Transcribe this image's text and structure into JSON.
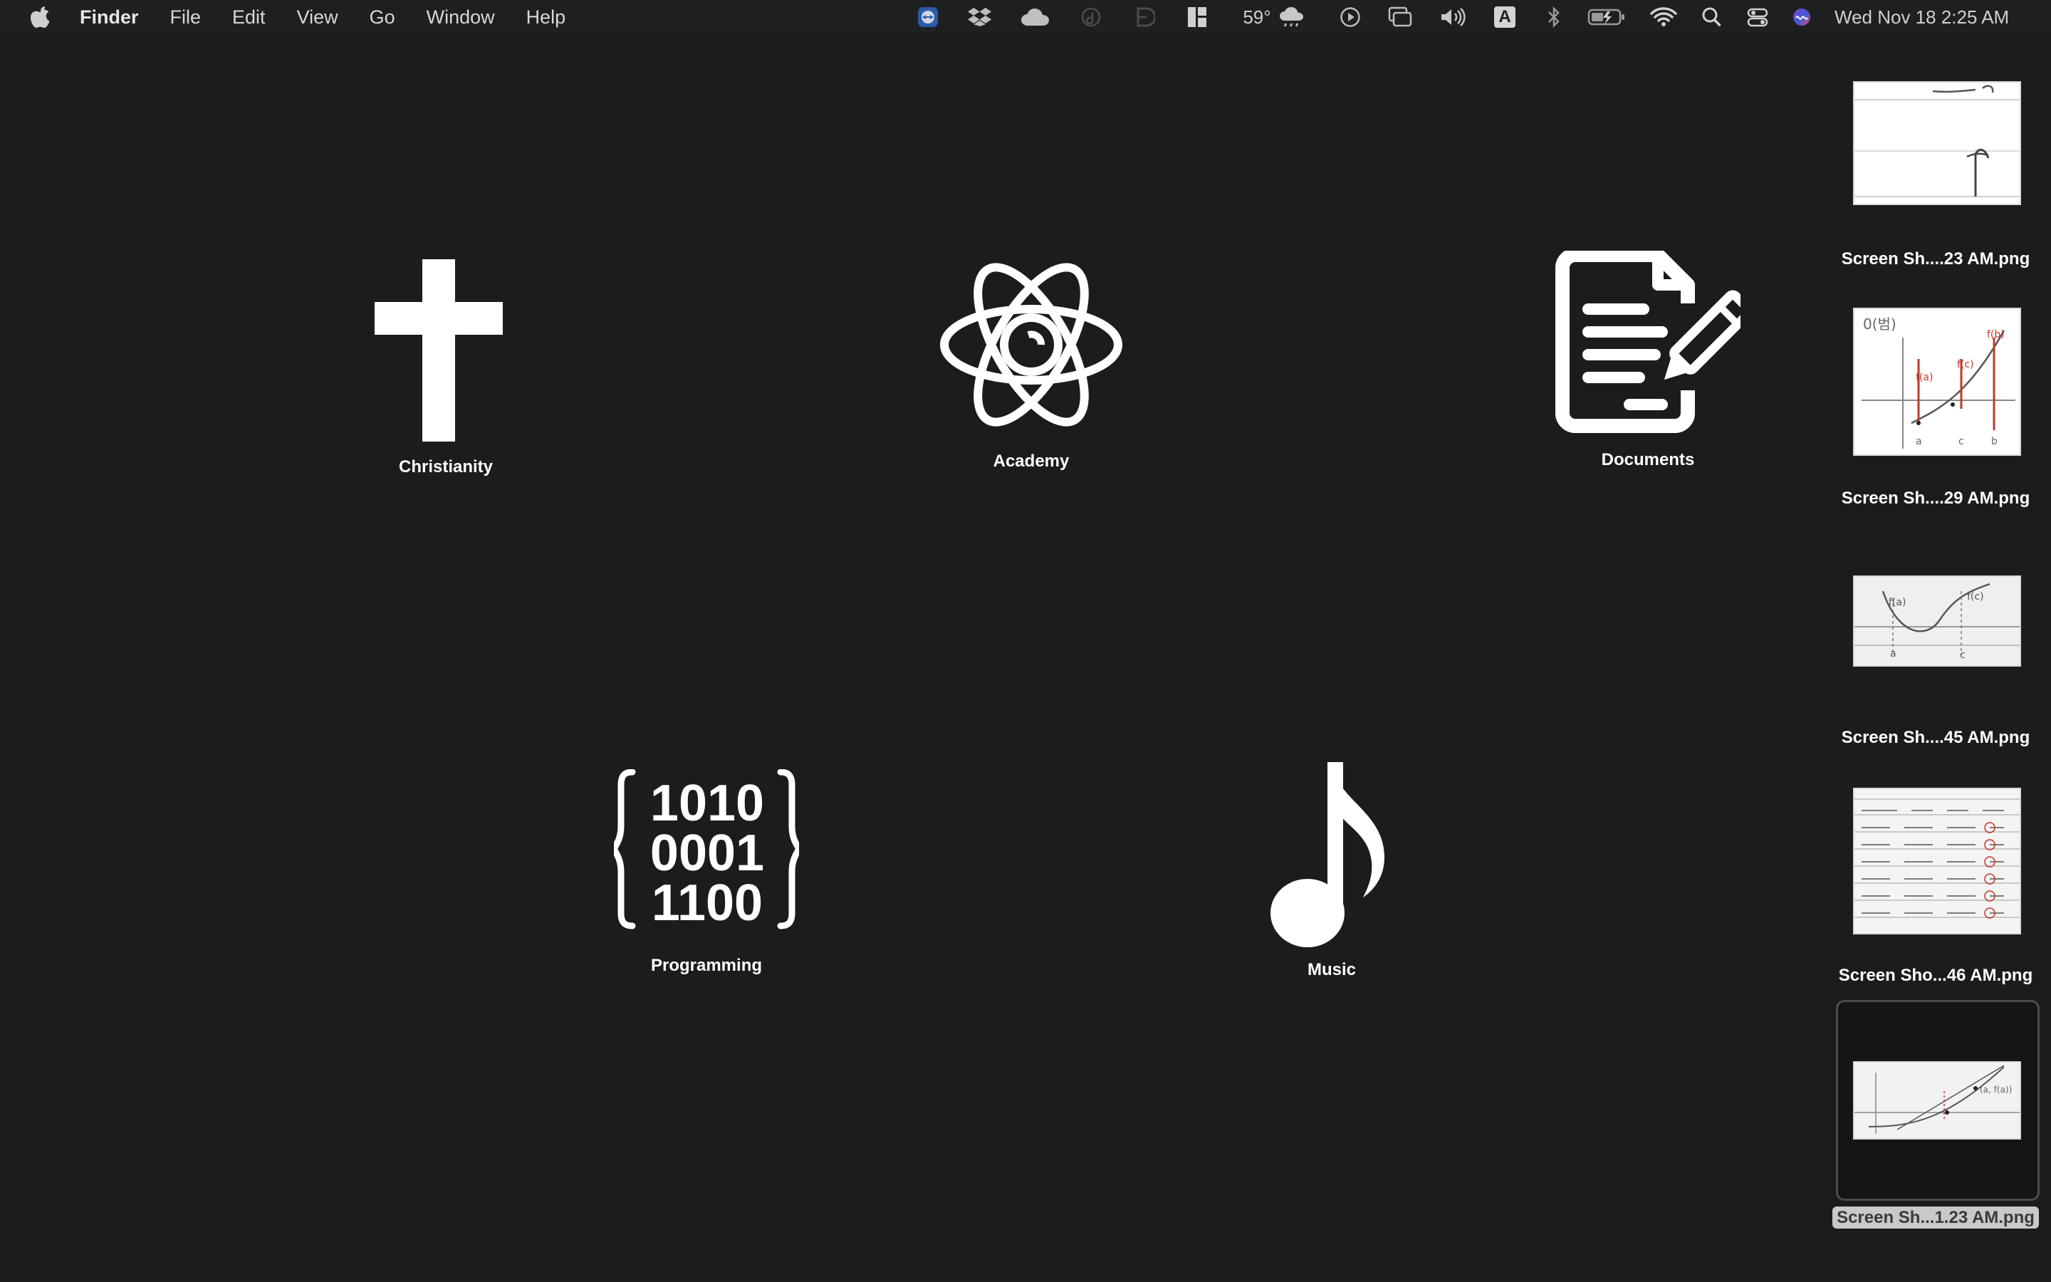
{
  "menubar": {
    "app_name": "Finder",
    "menus": [
      "File",
      "Edit",
      "View",
      "Go",
      "Window",
      "Help"
    ],
    "weather_temp": "59°",
    "clock": "Wed Nov 18  2:25 AM",
    "input_source": "A",
    "status_icons": [
      "teamviewer-icon",
      "dropbox-icon",
      "cloud-icon",
      "dash-icon",
      "bartender-icon",
      "layout-icon",
      "weather-icon",
      "play-icon",
      "screens-icon",
      "volume-icon",
      "input-source-icon",
      "bluetooth-icon",
      "battery-icon",
      "wifi-icon",
      "spotlight-icon",
      "control-center-icon",
      "siri-icon"
    ]
  },
  "desktop": {
    "folders": [
      {
        "label": "Christianity",
        "icon": "cross-icon"
      },
      {
        "label": "Academy",
        "icon": "atom-icon"
      },
      {
        "label": "Documents",
        "icon": "document-pencil-icon"
      },
      {
        "label": "Programming",
        "icon": "binary-code-icon"
      },
      {
        "label": "Music",
        "icon": "music-note-icon"
      }
    ],
    "screenshots": [
      {
        "label": "Screen Sh....23 AM.png"
      },
      {
        "label": "Screen Sh....29 AM.png"
      },
      {
        "label": "Screen Sh....45 AM.png"
      },
      {
        "label": "Screen Sho...46 AM.png"
      },
      {
        "label": "Screen Sh...1.23 AM.png",
        "selected": true
      }
    ]
  },
  "colors": {
    "desktop_bg": "#1b1c1e",
    "menubar_bg": "#1e1f21",
    "selection_label_bg": "#c9c9cc"
  }
}
